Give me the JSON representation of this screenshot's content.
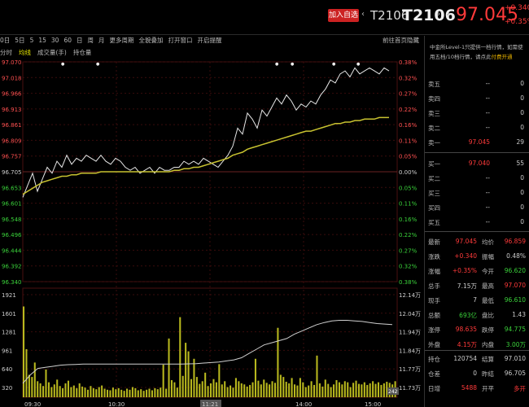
{
  "header": {
    "fav_button": "加入自选",
    "nav_prev": "‹",
    "code1": "T2106",
    "code2": "T2106",
    "nav_next": "›",
    "menu_dot": "•",
    "price": "97.045",
    "change": "+0.340",
    "change_pct": "+0.35%"
  },
  "toolbar": {
    "items": [
      "0日",
      "5日",
      "5",
      "15",
      "30",
      "60",
      "日",
      "周",
      "月",
      "更多周期",
      "全貌叠加",
      "打开窗口",
      "开启提醒"
    ],
    "right_items": [
      "前往首页",
      "隐藏"
    ],
    "sub_items": [
      "分时",
      "均线",
      "成交量(手)",
      "持仓量"
    ]
  },
  "chart_data": [
    {
      "type": "line",
      "panel": "price",
      "y_left_labels": [
        "97.070",
        "97.018",
        "96.966",
        "96.913",
        "96.861",
        "96.809",
        "96.757",
        "96.705",
        "96.653",
        "96.601",
        "96.548",
        "96.496",
        "96.444",
        "96.392",
        "96.340"
      ],
      "y_right_labels": [
        "0.38%",
        "0.32%",
        "0.27%",
        "0.22%",
        "0.16%",
        "0.11%",
        "0.05%",
        "0.00%",
        "0.05%",
        "0.11%",
        "0.16%",
        "0.22%",
        "0.27%",
        "0.32%",
        "0.38%"
      ],
      "ylim": [
        96.34,
        97.07
      ],
      "ref_price": 96.705,
      "series": [
        {
          "color": "#e6e6e6",
          "values": [
            96.62,
            96.66,
            96.7,
            96.64,
            96.68,
            96.72,
            96.7,
            96.74,
            96.72,
            96.76,
            96.73,
            96.75,
            96.74,
            96.76,
            96.75,
            96.74,
            96.76,
            96.74,
            96.73,
            96.75,
            96.74,
            96.72,
            96.71,
            96.72,
            96.7,
            96.71,
            96.72,
            96.7,
            96.72,
            96.71,
            96.71,
            96.72,
            96.72,
            96.74,
            96.73,
            96.74,
            96.73,
            96.75,
            96.74,
            96.73,
            96.72,
            96.74,
            96.76,
            96.79,
            96.85,
            96.83,
            96.9,
            96.88,
            96.85,
            96.91,
            96.89,
            96.92,
            96.95,
            96.93,
            96.96,
            96.94,
            96.91,
            96.93,
            96.92,
            96.94,
            96.93,
            96.96,
            96.98,
            97.01,
            97.0,
            97.03,
            97.04,
            97.02,
            97.05,
            97.03,
            97.04,
            97.05,
            97.04,
            97.03,
            97.05,
            97.04
          ]
        },
        {
          "color": "#c8c230",
          "values": [
            96.63,
            96.64,
            96.65,
            96.66,
            96.67,
            96.675,
            96.68,
            96.685,
            96.69,
            96.69,
            96.695,
            96.695,
            96.7,
            96.7,
            96.7,
            96.7,
            96.705,
            96.705,
            96.705,
            96.705,
            96.705,
            96.705,
            96.705,
            96.705,
            96.705,
            96.705,
            96.705,
            96.705,
            96.705,
            96.705,
            96.705,
            96.71,
            96.71,
            96.715,
            96.715,
            96.72,
            96.72,
            96.725,
            96.73,
            96.735,
            96.74,
            96.745,
            96.75,
            96.76,
            96.765,
            96.77,
            96.78,
            96.785,
            96.79,
            96.795,
            96.8,
            96.805,
            96.81,
            96.815,
            96.82,
            96.825,
            96.83,
            96.835,
            96.84,
            96.84,
            96.845,
            96.85,
            96.855,
            96.86,
            96.865,
            96.865,
            96.87,
            96.87,
            96.875,
            96.875,
            96.88,
            96.88,
            96.88,
            96.885,
            96.885,
            96.885
          ]
        }
      ]
    },
    {
      "type": "bar",
      "panel": "volume",
      "y_left_labels": [
        "1921",
        "1601",
        "1281",
        "961",
        "640",
        "320"
      ],
      "y_right_labels": [
        "12.14万",
        "12.04万",
        "11.94万",
        "11.84万",
        "11.77万",
        "11.73万"
      ],
      "ylim": [
        0,
        1921
      ],
      "right_tag": "242",
      "x_labels": [
        "09:30",
        "10:30",
        "11:21",
        "14:00",
        "15:00"
      ],
      "bars": [
        1700,
        900,
        420,
        380,
        650,
        300,
        260,
        210,
        520,
        280,
        190,
        240,
        330,
        210,
        170,
        260,
        310,
        190,
        220,
        170,
        260,
        200,
        180,
        140,
        210,
        170,
        150,
        190,
        220,
        160,
        140,
        130,
        180,
        150,
        170,
        140,
        120,
        160,
        140,
        190,
        170,
        130,
        150,
        120,
        140,
        160,
        130,
        170,
        150,
        180,
        610,
        160,
        1100,
        320,
        280,
        180,
        1500,
        400,
        1020,
        860,
        340,
        720,
        380,
        250,
        300,
        460,
        210,
        260,
        340,
        280,
        620,
        240,
        300,
        190,
        220,
        180,
        360,
        300,
        260,
        240,
        200,
        230,
        280,
        720,
        310,
        240,
        330,
        270,
        240,
        300,
        270,
        1300,
        420,
        380,
        290,
        260,
        360,
        240,
        220,
        360,
        280,
        190,
        220,
        300,
        230,
        780,
        260,
        200,
        330,
        250,
        190,
        240,
        320,
        280,
        240,
        300,
        280,
        190,
        270,
        310,
        250,
        240,
        280,
        230,
        260,
        300,
        250,
        280,
        230,
        260,
        290,
        270,
        240,
        300
      ],
      "oi_line": [
        260,
        420,
        540,
        560,
        580,
        600,
        610,
        615,
        620,
        620,
        620,
        620,
        620,
        620,
        620,
        620,
        620,
        620,
        620,
        620,
        620,
        620,
        625,
        630,
        640,
        650,
        660,
        680,
        700,
        740,
        820,
        900,
        980,
        1020,
        1060,
        1100,
        1180,
        1240,
        1300,
        1360,
        1400,
        1430,
        1440,
        1440,
        1430,
        1420,
        1400,
        1380,
        1370,
        1360
      ]
    }
  ],
  "notice": {
    "text": "中金所Level-1只提供一档行情，如需使用五档/10档行情，请点此",
    "link": "付费开通"
  },
  "order_book": {
    "asks": [
      {
        "label": "卖五",
        "price": "--",
        "vol": "0"
      },
      {
        "label": "卖四",
        "price": "--",
        "vol": "0"
      },
      {
        "label": "卖三",
        "price": "--",
        "vol": "0"
      },
      {
        "label": "卖二",
        "price": "--",
        "vol": "0"
      },
      {
        "label": "卖一",
        "price": "97.045",
        "vol": "29"
      }
    ],
    "bids": [
      {
        "label": "买一",
        "price": "97.040",
        "vol": "55"
      },
      {
        "label": "买二",
        "price": "--",
        "vol": "0"
      },
      {
        "label": "买三",
        "price": "--",
        "vol": "0"
      },
      {
        "label": "买四",
        "price": "--",
        "vol": "0"
      },
      {
        "label": "买五",
        "price": "--",
        "vol": "0"
      }
    ]
  },
  "stats": [
    {
      "l1": "最新",
      "v1": "97.045",
      "c1": "#ff3a3a",
      "l2": "均价",
      "v2": "96.859",
      "c2": "#ff3a3a"
    },
    {
      "l1": "涨跌",
      "v1": "+0.340",
      "c1": "#ff3a3a",
      "l2": "振幅",
      "v2": "0.48%",
      "c2": "#ccc"
    },
    {
      "l1": "涨幅",
      "v1": "+0.35%",
      "c1": "#ff3a3a",
      "l2": "今开",
      "v2": "96.620",
      "c2": "#3ad13a"
    },
    {
      "l1": "总手",
      "v1": "7.15万",
      "c1": "#ccc",
      "l2": "最高",
      "v2": "97.070",
      "c2": "#ff3a3a"
    },
    {
      "l1": "现手",
      "v1": "7",
      "c1": "#ccc",
      "l2": "最低",
      "v2": "96.610",
      "c2": "#3ad13a"
    },
    {
      "l1": "总额",
      "v1": "693亿",
      "c1": "#3ad13a",
      "l2": "盘比",
      "v2": "1.43",
      "c2": "#ccc"
    },
    {
      "l1": "涨停",
      "v1": "98.635",
      "c1": "#ff3a3a",
      "l2": "跌停",
      "v2": "94.775",
      "c2": "#3ad13a"
    },
    {
      "l1": "外盘",
      "v1": "4.15万",
      "c1": "#ff3a3a",
      "l2": "内盘",
      "v2": "3.00万",
      "c2": "#3ad13a"
    },
    {
      "l1": "持仓",
      "v1": "120754",
      "c1": "#ccc",
      "l2": "结算",
      "v2": "97.010",
      "c2": "#ccc"
    },
    {
      "l1": "仓差",
      "v1": "0",
      "c1": "#ccc",
      "l2": "昨结",
      "v2": "96.705",
      "c2": "#ccc"
    },
    {
      "l1": "日增",
      "v1": "5488",
      "c1": "#ff3a3a",
      "l2": "开平",
      "v2": "多开",
      "c2": "#ff3a3a"
    }
  ]
}
